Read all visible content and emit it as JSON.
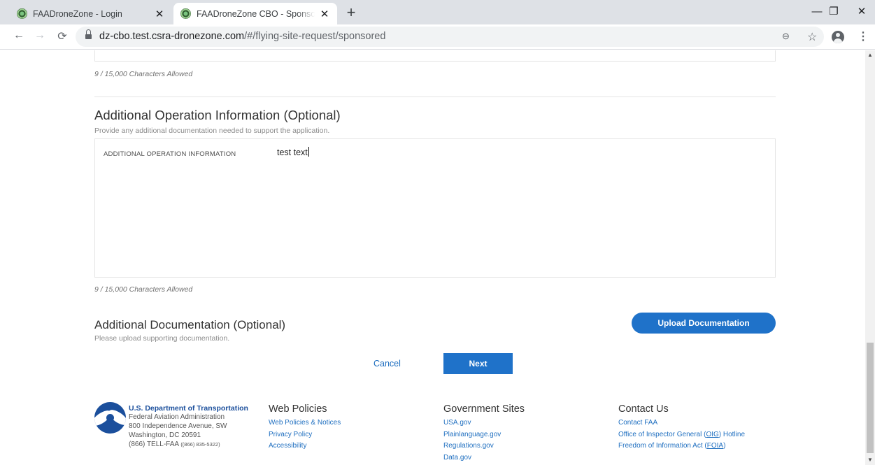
{
  "browser": {
    "tabs": [
      {
        "title": "FAADroneZone - Login",
        "close": "✕"
      },
      {
        "title": "FAADroneZone CBO - Sponsored",
        "close": "✕"
      }
    ],
    "new_tab": "+",
    "window_controls": {
      "minimize": "—",
      "maximize": "❐",
      "close": "✕"
    },
    "nav": {
      "back": "←",
      "forward": "→",
      "reload": "⟳"
    },
    "url_host": "dz-cbo.test.csra-dronezone.com",
    "url_path": "/#/flying-site-request/sponsored",
    "zoom": "⊖",
    "star": "☆",
    "menu": "⋮"
  },
  "page": {
    "prev_char_count": "9 / 15,000 Characters Allowed",
    "additional_info": {
      "title": "Additional Operation Information (Optional)",
      "subtitle": "Provide any additional documentation needed to support the application.",
      "field_label": "ADDITIONAL OPERATION INFORMATION",
      "field_value": "test text",
      "char_count": "9 / 15,000 Characters Allowed"
    },
    "documentation": {
      "title": "Additional Documentation (Optional)",
      "subtitle": "Please upload supporting documentation.",
      "upload_label": "Upload Documentation"
    },
    "actions": {
      "cancel": "Cancel",
      "next": "Next"
    }
  },
  "footer": {
    "dot": {
      "name": "U.S. Department of Transportation",
      "agency": "Federal Aviation Administration",
      "street": "800 Independence Avenue, SW",
      "city": "Washington, DC 20591",
      "phone": "(866) TELL-FAA",
      "phone_alt": "((866) 835-5322)"
    },
    "web_policies": {
      "heading": "Web Policies",
      "links": [
        "Web Policies & Notices",
        "Privacy Policy",
        "Accessibility"
      ]
    },
    "government_sites": {
      "heading": "Government Sites",
      "links": [
        "USA.gov",
        "Plainlanguage.gov",
        "Regulations.gov",
        "Data.gov"
      ]
    },
    "contact": {
      "heading": "Contact Us",
      "link1": "Contact FAA",
      "oig_pre": "Office of Inspector General (",
      "oig_abbr": "OIG",
      "oig_post": ") Hotline",
      "foia_pre": "Freedom of Information Act (",
      "foia_abbr": "FOIA",
      "foia_post": ")"
    }
  },
  "scrollbar": {
    "up": "▲",
    "down": "▼"
  }
}
